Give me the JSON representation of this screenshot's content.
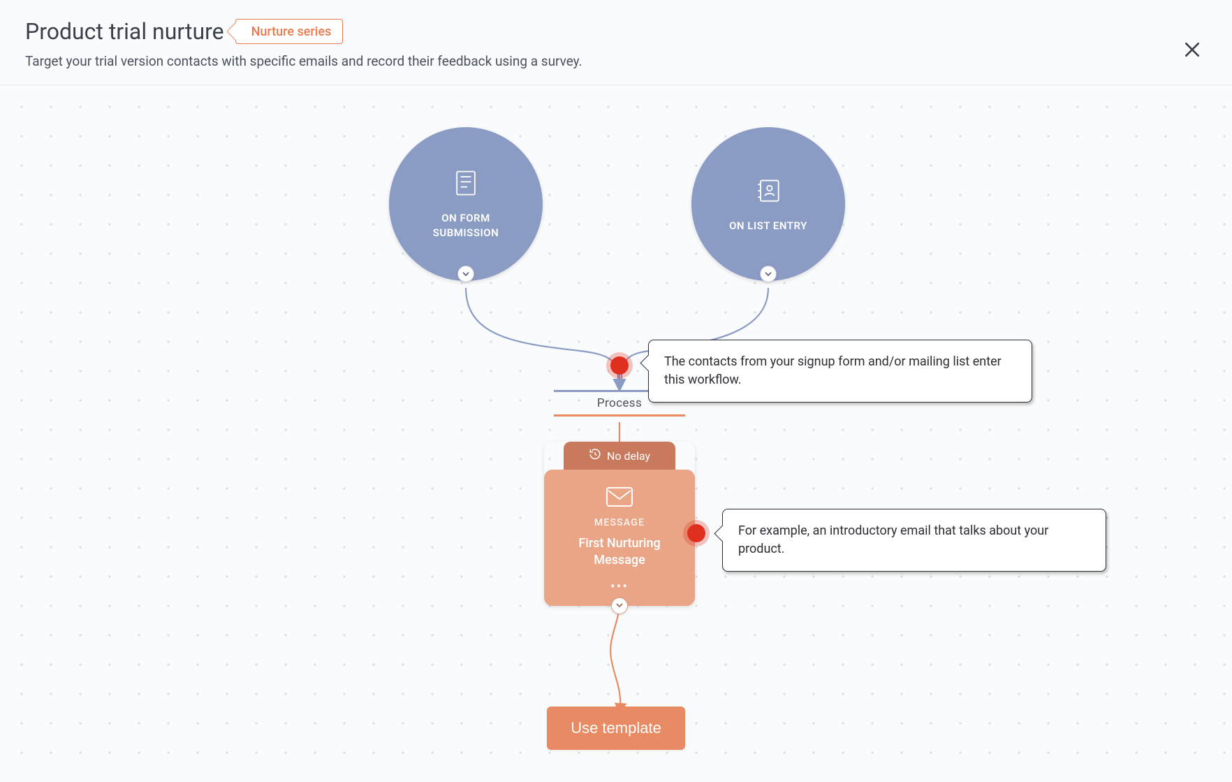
{
  "header": {
    "title": "Product trial nurture",
    "tag": "Nurture series",
    "subtitle": "Target your trial version contacts with specific emails and record their feedback using a survey."
  },
  "triggers": {
    "form": {
      "label": "ON FORM SUBMISSION",
      "icon": "form-icon"
    },
    "list": {
      "label": "ON LIST ENTRY",
      "icon": "contact-list-icon"
    }
  },
  "process_label": "Process",
  "action": {
    "delay_label": "No delay",
    "type_label": "MESSAGE",
    "title": "First Nurturing Message"
  },
  "callouts": {
    "entry": "The contacts from your signup form and/or mailing list enter this workflow.",
    "message": "For example, an introductory email that talks about your product."
  },
  "cta": {
    "button_label": "Use template"
  },
  "colors": {
    "trigger_fill": "#8a9bc4",
    "action_fill": "#e9a586",
    "delay_fill": "#c97a5d",
    "accent": "#e88a63",
    "highlight": "#e02f1f"
  }
}
